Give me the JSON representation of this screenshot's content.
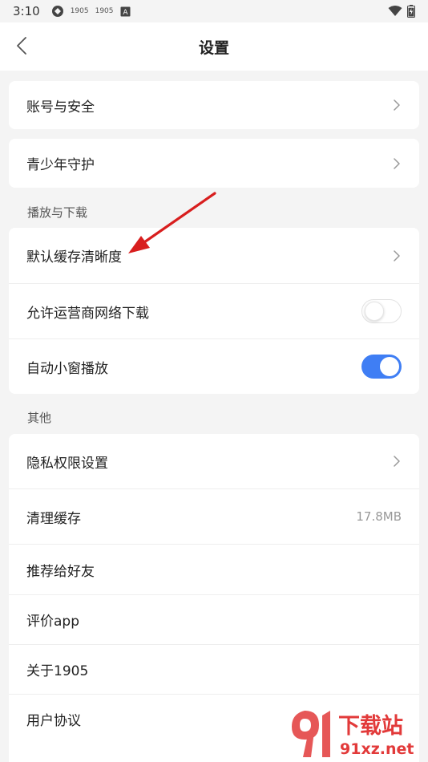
{
  "status_bar": {
    "time": "3:10",
    "icon_labels": [
      "1905",
      "1905"
    ],
    "battery_level": 0.9
  },
  "nav": {
    "title": "设置"
  },
  "groups": {
    "account": {
      "label": "账号与安全"
    },
    "youth": {
      "label": "青少年守护"
    },
    "playback": {
      "title": "播放与下载",
      "items": [
        {
          "label": "默认缓存清晰度"
        },
        {
          "label": "允许运营商网络下载",
          "toggle_on": false
        },
        {
          "label": "自动小窗播放",
          "toggle_on": true
        }
      ]
    },
    "other": {
      "title": "其他",
      "items": [
        {
          "label": "隐私权限设置"
        },
        {
          "label": "清理缓存",
          "value": "17.8MB"
        },
        {
          "label": "推荐给好友"
        },
        {
          "label": "评价app"
        },
        {
          "label": "关于1905"
        },
        {
          "label": "用户协议"
        }
      ]
    }
  },
  "watermark": {
    "brand": "下载站",
    "domain": "91xz.net"
  },
  "colors": {
    "accent": "#3f7ef4",
    "annotation": "#d81e1e",
    "watermark": "#e23a3a"
  }
}
